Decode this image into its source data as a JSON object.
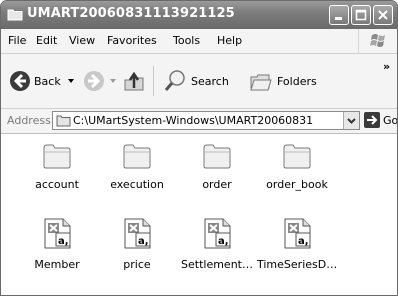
{
  "window": {
    "title": "UMART20060831113921125",
    "controls": {
      "minimize": "minimize",
      "maximize": "maximize",
      "close": "close"
    }
  },
  "menu": [
    "File",
    "Edit",
    "View",
    "Favorites",
    "Tools",
    "Help"
  ],
  "toolbar": {
    "back": "Back",
    "search": "Search",
    "folders": "Folders",
    "overflow": "»"
  },
  "address": {
    "label": "Address",
    "path": "C:\\UMartSystem-Windows\\UMART20060831",
    "go": "Go"
  },
  "folders": [
    {
      "name": "account",
      "icon": "folder-icon"
    },
    {
      "name": "execution",
      "icon": "folder-icon"
    },
    {
      "name": "order",
      "icon": "folder-icon"
    },
    {
      "name": "order_book",
      "icon": "folder-icon"
    }
  ],
  "files": [
    {
      "name": "Member",
      "icon": "csv-file-icon"
    },
    {
      "name": "price",
      "icon": "csv-file-icon"
    },
    {
      "name": "Settlement…",
      "icon": "csv-file-icon"
    },
    {
      "name": "TimeSeriesD…",
      "icon": "csv-file-icon"
    }
  ]
}
